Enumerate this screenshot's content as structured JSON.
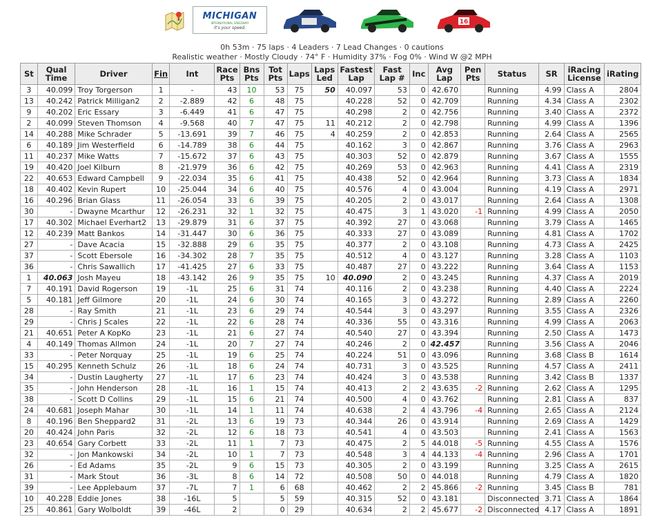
{
  "summary": {
    "line1": "0h 53m · 75 laps · 4 Leaders · 7 Lead Changes · 0 cautions",
    "line2": "Realistic weather · Mostly Cloudy · 74° F · Humidity 37% · Fog 0% · Wind W @2 MPH"
  },
  "track_logo": {
    "name": "MICHIGAN",
    "sub": "INTERNATIONAL SPEEDWAY",
    "tag": "it's your speed."
  },
  "car_colors": [
    "#2b4a8a",
    "#2fb34a",
    "#d8232a"
  ],
  "car_numbers": [
    "",
    "",
    "16"
  ],
  "columns": [
    "St",
    "Qual Time",
    "Driver",
    "Fin",
    "Int",
    "Race Pts",
    "Bns Pts",
    "Tot Pts",
    "Laps",
    "Laps Led",
    "Fastest Lap",
    "Fast Lap #",
    "Inc",
    "Avg Lap",
    "Pen Pts",
    "Status",
    "SR",
    "iRacing License",
    "iRating"
  ],
  "rows": [
    [
      "3",
      "40.099",
      "Troy Torgerson",
      "1",
      "-",
      "43",
      "10",
      "53",
      "75",
      "50",
      "40.097",
      "53",
      "0",
      "42.670",
      "",
      "Running",
      "4.99",
      "Class A",
      "2804"
    ],
    [
      "13",
      "40.242",
      "Patrick Milligan2",
      "2",
      "-2.889",
      "42",
      "6",
      "48",
      "75",
      "",
      "40.228",
      "52",
      "0",
      "42.709",
      "",
      "Running",
      "4.34",
      "Class A",
      "2302"
    ],
    [
      "9",
      "40.202",
      "Eric Essary",
      "3",
      "-6.449",
      "41",
      "6",
      "47",
      "75",
      "",
      "40.298",
      "2",
      "0",
      "42.756",
      "",
      "Running",
      "3.40",
      "Class A",
      "2372"
    ],
    [
      "2",
      "40.099",
      "Steven Thomson",
      "4",
      "-9.568",
      "40",
      "7",
      "47",
      "75",
      "11",
      "40.212",
      "2",
      "0",
      "42.798",
      "",
      "Running",
      "4.99",
      "Class A",
      "1396"
    ],
    [
      "14",
      "40.288",
      "Mike Schrader",
      "5",
      "-13.691",
      "39",
      "7",
      "46",
      "75",
      "4",
      "40.259",
      "2",
      "0",
      "42.853",
      "",
      "Running",
      "2.64",
      "Class A",
      "2565"
    ],
    [
      "6",
      "40.189",
      "Jim Westerfield",
      "6",
      "-14.789",
      "38",
      "6",
      "44",
      "75",
      "",
      "40.162",
      "3",
      "0",
      "42.867",
      "",
      "Running",
      "3.76",
      "Class A",
      "2963"
    ],
    [
      "11",
      "40.237",
      "Mike Watts",
      "7",
      "-15.672",
      "37",
      "6",
      "43",
      "75",
      "",
      "40.303",
      "52",
      "0",
      "42.879",
      "",
      "Running",
      "3.67",
      "Class A",
      "1555"
    ],
    [
      "19",
      "40.420",
      "Joel Kilburn",
      "8",
      "-21.979",
      "36",
      "6",
      "42",
      "75",
      "",
      "40.269",
      "53",
      "0",
      "42.963",
      "",
      "Running",
      "4.41",
      "Class A",
      "2319"
    ],
    [
      "22",
      "40.653",
      "Edward Campbell",
      "9",
      "-22.034",
      "35",
      "6",
      "41",
      "75",
      "",
      "40.438",
      "52",
      "0",
      "42.964",
      "",
      "Running",
      "3.73",
      "Class A",
      "1834"
    ],
    [
      "18",
      "40.402",
      "Kevin Rupert",
      "10",
      "-25.044",
      "34",
      "6",
      "40",
      "75",
      "",
      "40.576",
      "4",
      "0",
      "43.004",
      "",
      "Running",
      "4.19",
      "Class A",
      "2971"
    ],
    [
      "16",
      "40.296",
      "Brian Glass",
      "11",
      "-26.054",
      "33",
      "6",
      "39",
      "75",
      "",
      "40.205",
      "2",
      "0",
      "43.017",
      "",
      "Running",
      "2.64",
      "Class A",
      "1308"
    ],
    [
      "30",
      "-",
      "Dwayne Mcarthur",
      "12",
      "-26.231",
      "32",
      "1",
      "32",
      "75",
      "",
      "40.475",
      "3",
      "1",
      "43.020",
      "-1",
      "Running",
      "4.99",
      "Class A",
      "2050"
    ],
    [
      "17",
      "40.302",
      "Michael Everhart2",
      "13",
      "-29.879",
      "31",
      "6",
      "37",
      "75",
      "",
      "40.392",
      "27",
      "0",
      "43.068",
      "",
      "Running",
      "3.79",
      "Class A",
      "1465"
    ],
    [
      "12",
      "40.239",
      "Matt Bankos",
      "14",
      "-31.447",
      "30",
      "6",
      "36",
      "75",
      "",
      "40.333",
      "27",
      "0",
      "43.089",
      "",
      "Running",
      "4.81",
      "Class A",
      "1702"
    ],
    [
      "27",
      "-",
      "Dave Acacia",
      "15",
      "-32.888",
      "29",
      "6",
      "35",
      "75",
      "",
      "40.377",
      "2",
      "0",
      "43.108",
      "",
      "Running",
      "4.73",
      "Class A",
      "2425"
    ],
    [
      "37",
      "-",
      "Scott Ebersole",
      "16",
      "-34.302",
      "28",
      "7",
      "35",
      "75",
      "",
      "40.512",
      "4",
      "0",
      "43.127",
      "",
      "Running",
      "3.28",
      "Class A",
      "1103"
    ],
    [
      "36",
      "-",
      "Chris Sawallich",
      "17",
      "-41.425",
      "27",
      "6",
      "33",
      "75",
      "",
      "40.487",
      "27",
      "0",
      "43.222",
      "",
      "Running",
      "3.64",
      "Class A",
      "1153"
    ],
    [
      "1",
      "40.063",
      "Josh Mayeu",
      "18",
      "-43.142",
      "26",
      "9",
      "35",
      "75",
      "10",
      "40.090",
      "2",
      "0",
      "43.245",
      "",
      "Running",
      "4.37",
      "Class A",
      "2019"
    ],
    [
      "7",
      "40.191",
      "David Rogerson",
      "19",
      "-1L",
      "25",
      "6",
      "31",
      "74",
      "",
      "40.116",
      "2",
      "0",
      "43.238",
      "",
      "Running",
      "4.40",
      "Class A",
      "2224"
    ],
    [
      "5",
      "40.181",
      "Jeff Gilmore",
      "20",
      "-1L",
      "24",
      "6",
      "30",
      "74",
      "",
      "40.165",
      "3",
      "0",
      "43.272",
      "",
      "Running",
      "2.89",
      "Class A",
      "2260"
    ],
    [
      "28",
      "-",
      "Ray Smith",
      "21",
      "-1L",
      "23",
      "6",
      "29",
      "74",
      "",
      "40.544",
      "3",
      "0",
      "43.297",
      "",
      "Running",
      "3.55",
      "Class A",
      "2326"
    ],
    [
      "29",
      "-",
      "Chris J Scales",
      "22",
      "-1L",
      "22",
      "6",
      "28",
      "74",
      "",
      "40.336",
      "55",
      "0",
      "43.316",
      "",
      "Running",
      "4.99",
      "Class A",
      "2063"
    ],
    [
      "21",
      "40.651",
      "Peter A KopKo",
      "23",
      "-1L",
      "21",
      "6",
      "27",
      "74",
      "",
      "40.540",
      "27",
      "0",
      "43.394",
      "",
      "Running",
      "2.50",
      "Class A",
      "1473"
    ],
    [
      "4",
      "40.149",
      "Thomas Allmon",
      "24",
      "-1L",
      "20",
      "7",
      "27",
      "74",
      "",
      "40.246",
      "2",
      "0",
      "42.457",
      "",
      "Running",
      "3.56",
      "Class A",
      "2046"
    ],
    [
      "33",
      "-",
      "Peter Norquay",
      "25",
      "-1L",
      "19",
      "6",
      "25",
      "74",
      "",
      "40.224",
      "51",
      "0",
      "43.096",
      "",
      "Running",
      "3.68",
      "Class B",
      "1614"
    ],
    [
      "15",
      "40.295",
      "Kenneth Schulz",
      "26",
      "-1L",
      "18",
      "6",
      "24",
      "74",
      "",
      "40.731",
      "3",
      "0",
      "43.525",
      "",
      "Running",
      "4.57",
      "Class A",
      "2411"
    ],
    [
      "34",
      "-",
      "Dustin Laugherty",
      "27",
      "-1L",
      "17",
      "6",
      "23",
      "74",
      "",
      "40.424",
      "3",
      "0",
      "43.538",
      "",
      "Running",
      "3.42",
      "Class B",
      "1337"
    ],
    [
      "35",
      "-",
      "John Henderson",
      "28",
      "-1L",
      "16",
      "1",
      "15",
      "74",
      "",
      "40.413",
      "2",
      "2",
      "43.635",
      "-2",
      "Running",
      "2.62",
      "Class A",
      "1295"
    ],
    [
      "38",
      "-",
      "Scott D Collins",
      "29",
      "-1L",
      "15",
      "6",
      "21",
      "74",
      "",
      "40.500",
      "4",
      "0",
      "43.762",
      "",
      "Running",
      "2.81",
      "Class A",
      "837"
    ],
    [
      "24",
      "40.681",
      "Joseph Mahar",
      "30",
      "-1L",
      "14",
      "1",
      "11",
      "74",
      "",
      "40.638",
      "2",
      "4",
      "43.796",
      "-4",
      "Running",
      "2.65",
      "Class A",
      "2124"
    ],
    [
      "8",
      "40.196",
      "Ben Sheppard2",
      "31",
      "-2L",
      "13",
      "6",
      "19",
      "73",
      "",
      "40.344",
      "26",
      "0",
      "43.914",
      "",
      "Running",
      "2.69",
      "Class A",
      "1429"
    ],
    [
      "20",
      "40.424",
      "John Paris",
      "32",
      "-2L",
      "12",
      "6",
      "18",
      "73",
      "",
      "40.541",
      "4",
      "0",
      "43.503",
      "",
      "Running",
      "2.41",
      "Class A",
      "1563"
    ],
    [
      "23",
      "40.654",
      "Gary Corbett",
      "33",
      "-2L",
      "11",
      "1",
      "7",
      "73",
      "",
      "40.475",
      "2",
      "5",
      "44.018",
      "-5",
      "Running",
      "4.55",
      "Class A",
      "1576"
    ],
    [
      "32",
      "-",
      "Jon Mankowski",
      "34",
      "-2L",
      "10",
      "1",
      "7",
      "73",
      "",
      "40.548",
      "3",
      "4",
      "44.133",
      "-4",
      "Running",
      "2.96",
      "Class A",
      "1701"
    ],
    [
      "26",
      "-",
      "Ed Adams",
      "35",
      "-2L",
      "9",
      "6",
      "15",
      "73",
      "",
      "40.305",
      "2",
      "0",
      "43.199",
      "",
      "Running",
      "3.25",
      "Class A",
      "2615"
    ],
    [
      "31",
      "-",
      "Mark Stout",
      "36",
      "-3L",
      "8",
      "6",
      "14",
      "72",
      "",
      "40.508",
      "50",
      "0",
      "44.018",
      "",
      "Running",
      "4.79",
      "Class A",
      "1820"
    ],
    [
      "39",
      "-",
      "Lee Applebaum",
      "37",
      "-7L",
      "7",
      "1",
      "6",
      "68",
      "",
      "40.462",
      "2",
      "2",
      "45.866",
      "-2",
      "Running",
      "3.45",
      "Class B",
      "781"
    ],
    [
      "10",
      "40.228",
      "Eddie Jones",
      "38",
      "-16L",
      "5",
      "",
      "5",
      "59",
      "",
      "40.315",
      "52",
      "0",
      "43.181",
      "",
      "Disconnected",
      "3.71",
      "Class A",
      "1864"
    ],
    [
      "25",
      "40.861",
      "Gary Wolboldt",
      "39",
      "-46L",
      "2",
      "",
      "0",
      "29",
      "",
      "40.634",
      "2",
      "2",
      "45.677",
      "-2",
      "Disconnected",
      "4.17",
      "Class A",
      "1891"
    ]
  ],
  "highlights": {
    "fastest_qual_row": 17,
    "most_laps_led_row": 0,
    "fastest_lap_row": 17,
    "best_avg_row": 23
  }
}
